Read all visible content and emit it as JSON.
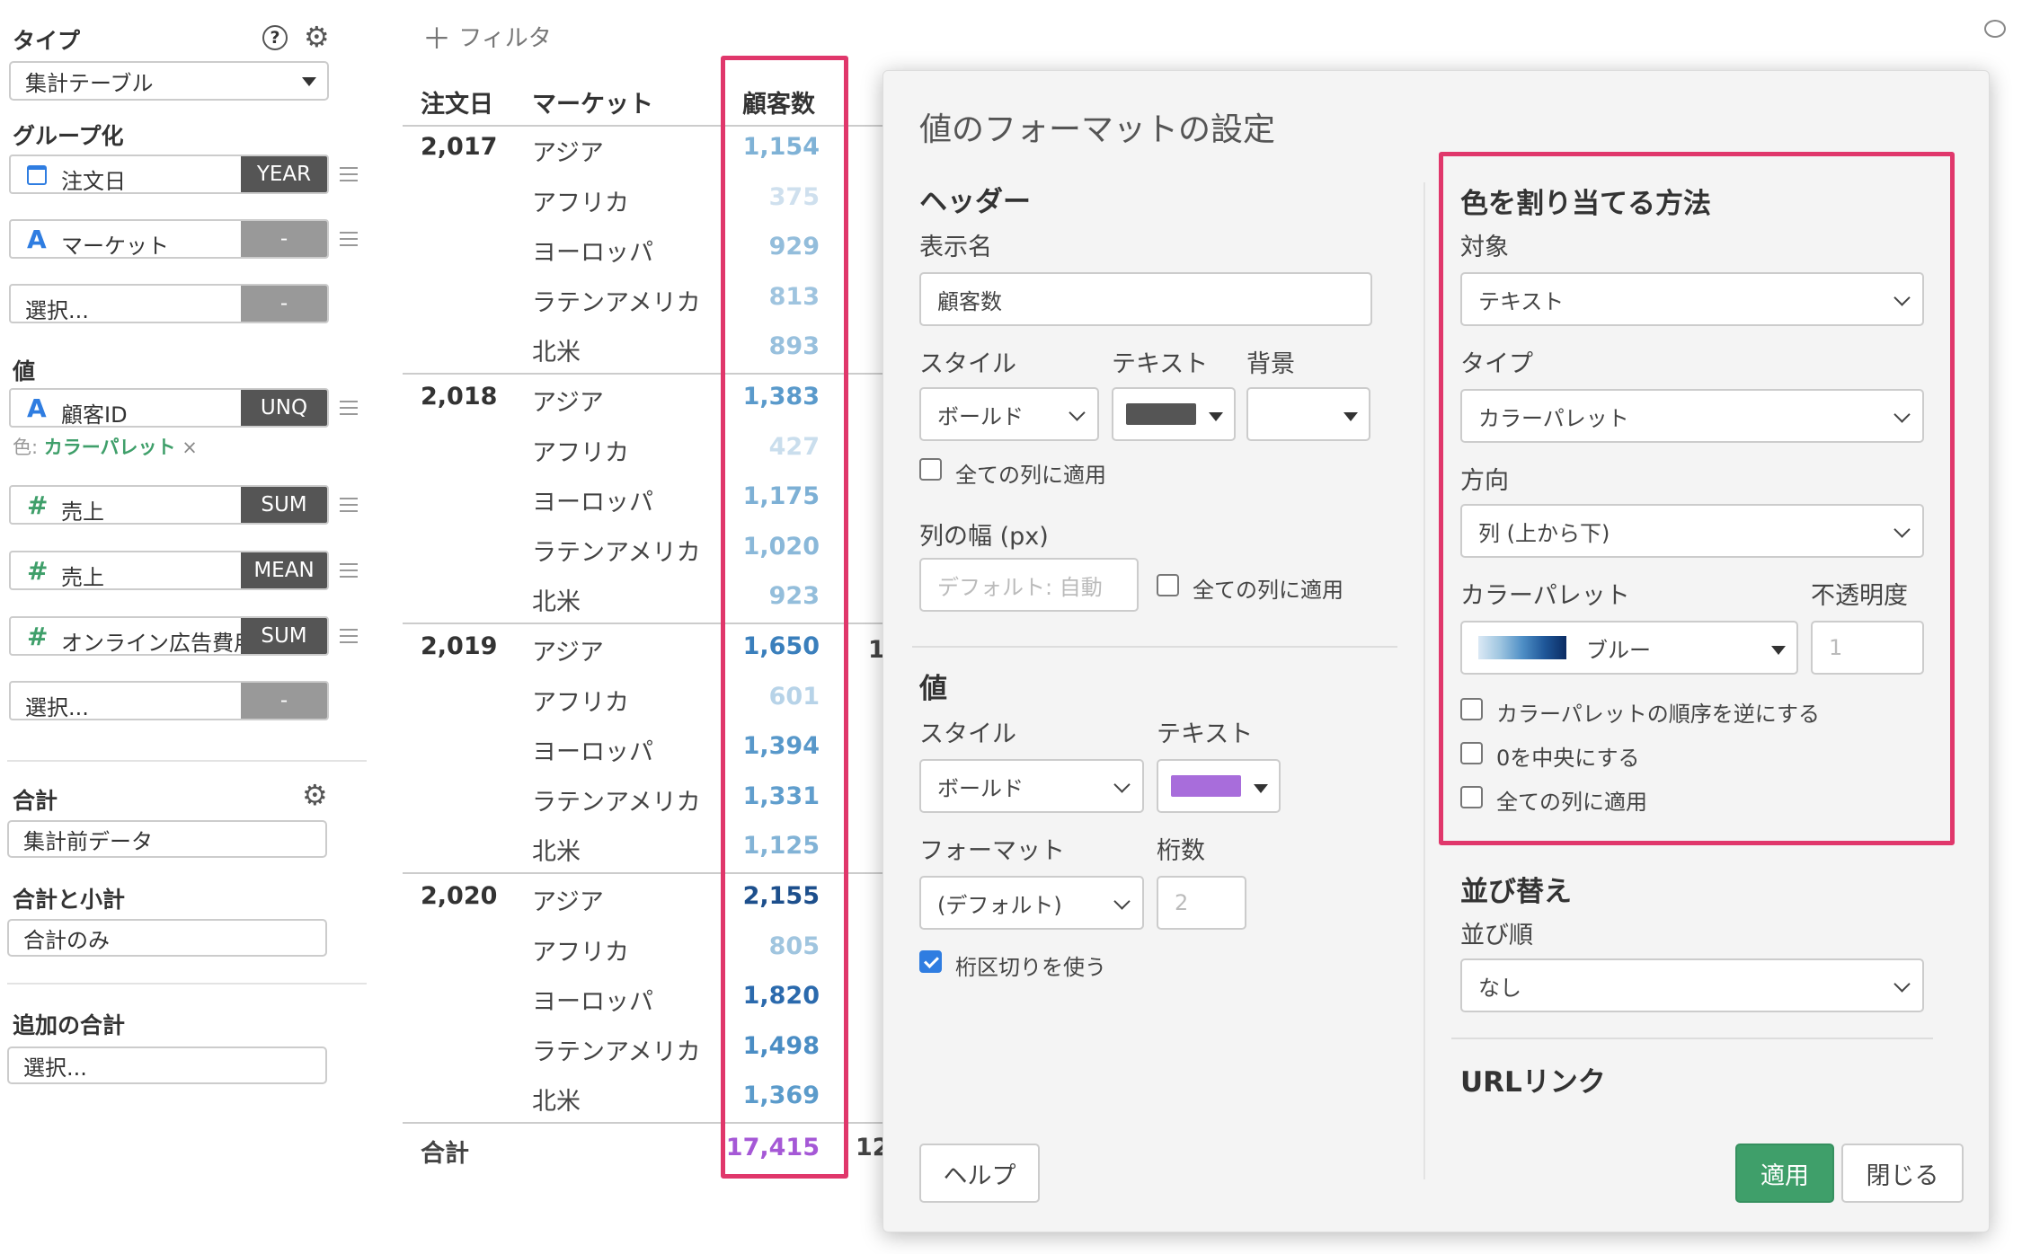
{
  "sidebar": {
    "type_label": "タイプ",
    "type_value": "集計テーブル",
    "group_label": "グループ化",
    "groups": [
      {
        "icon": "calendar-icon",
        "name": "注文日",
        "tag": "YEAR"
      },
      {
        "icon": "A",
        "name": "マーケット",
        "tag": "-"
      },
      {
        "icon": "",
        "name": "選択...",
        "tag": "-"
      }
    ],
    "value_label": "値",
    "values": [
      {
        "icon": "A",
        "name": "顧客ID",
        "tag": "UNQ"
      },
      {
        "icon": "#",
        "name": "売上",
        "tag": "SUM"
      },
      {
        "icon": "#",
        "name": "売上",
        "tag": "MEAN"
      },
      {
        "icon": "#",
        "name": "オンライン広告費用",
        "tag": "SUM"
      },
      {
        "icon": "",
        "name": "選択...",
        "tag": "-"
      }
    ],
    "color_prefix": "色:",
    "color_value": "カラーパレット",
    "color_remove": "×",
    "total_label": "合計",
    "total_value": "集計前データ",
    "subtotal_label": "合計と小計",
    "subtotal_value": "合計のみ",
    "extra_total_label": "追加の合計",
    "extra_total_value": "選択..."
  },
  "toolbar": {
    "filter_label": "フィルタ"
  },
  "table": {
    "headers": {
      "order_date": "注文日",
      "market": "マーケット",
      "customers": "顧客数"
    },
    "groups": [
      {
        "year": "2,017",
        "rows": [
          {
            "market": "アジア",
            "value": "1,154",
            "color": "#7fb2d6"
          },
          {
            "market": "アフリカ",
            "value": "375",
            "color": "#cfe0ee"
          },
          {
            "market": "ヨーロッパ",
            "value": "929",
            "color": "#93bddb"
          },
          {
            "market": "ラテンアメリカ",
            "value": "813",
            "color": "#9fc4df"
          },
          {
            "market": "北米",
            "value": "893",
            "color": "#98c0dd"
          }
        ]
      },
      {
        "year": "2,018",
        "rows": [
          {
            "market": "アジア",
            "value": "1,383",
            "color": "#5a9acb"
          },
          {
            "market": "アフリカ",
            "value": "427",
            "color": "#cadeed"
          },
          {
            "market": "ヨーロッパ",
            "value": "1,175",
            "color": "#7db0d5"
          },
          {
            "market": "ラテンアメリカ",
            "value": "1,020",
            "color": "#8ab8d9"
          },
          {
            "market": "北米",
            "value": "923",
            "color": "#94bedb"
          }
        ]
      },
      {
        "year": "2,019",
        "rows": [
          {
            "market": "アジア",
            "value": "1,650",
            "color": "#3a7fbc"
          },
          {
            "market": "アフリカ",
            "value": "601",
            "color": "#b7d3e8"
          },
          {
            "market": "ヨーロッパ",
            "value": "1,394",
            "color": "#5898ca"
          },
          {
            "market": "ラテンアメリカ",
            "value": "1,331",
            "color": "#609ecd"
          },
          {
            "market": "北米",
            "value": "1,125",
            "color": "#82b3d6"
          }
        ]
      },
      {
        "year": "2,020",
        "rows": [
          {
            "market": "アジア",
            "value": "2,155",
            "color": "#1d4f8c"
          },
          {
            "market": "アフリカ",
            "value": "805",
            "color": "#a0c5df"
          },
          {
            "market": "ヨーロッパ",
            "value": "1,820",
            "color": "#2b6aad"
          },
          {
            "market": "ラテンアメリカ",
            "value": "1,498",
            "color": "#4a8dc4"
          },
          {
            "market": "北米",
            "value": "1,369",
            "color": "#5b9bcb"
          }
        ]
      }
    ],
    "total_label": "合計",
    "total_value": "17,415",
    "total_color": "#a558d6",
    "cut_next_col": [
      "1",
      "12"
    ]
  },
  "dialog": {
    "title": "値のフォーマットの設定",
    "header_section": "ヘッダー",
    "display_name_label": "表示名",
    "display_name_value": "顧客数",
    "style_label": "スタイル",
    "text_label": "テキスト",
    "bg_label": "背景",
    "header_style_value": "ボールド",
    "header_text_color": "#555555",
    "apply_all_cols": "全ての列に適用",
    "col_width_label": "列の幅 (px)",
    "col_width_placeholder": "デフォルト: 自動",
    "value_section": "値",
    "value_style_value": "ボールド",
    "value_text_color": "#a86ddb",
    "format_label": "フォーマット",
    "digits_label": "桁数",
    "format_value": "(デフォルト)",
    "digits_placeholder": "2",
    "use_separator": "桁区切りを使う",
    "color_section": "色を割り当てる方法",
    "target_label": "対象",
    "target_value": "テキスト",
    "type_label": "タイプ",
    "type_value": "カラーパレット",
    "direction_label": "方向",
    "direction_value": "列 (上から下)",
    "palette_label": "カラーパレット",
    "opacity_label": "不透明度",
    "palette_value": "ブルー",
    "opacity_placeholder": "1",
    "reverse_palette": "カラーパレットの順序を逆にする",
    "center_zero": "0を中央にする",
    "sort_section": "並び替え",
    "sort_order_label": "並び順",
    "sort_order_value": "なし",
    "url_section": "URLリンク",
    "help_button": "ヘルプ",
    "apply_button": "適用",
    "close_button": "閉じる"
  },
  "colors": {
    "highlight": "#e0376b",
    "primary": "#3f9f6a",
    "link_green": "#3f9f6a"
  }
}
